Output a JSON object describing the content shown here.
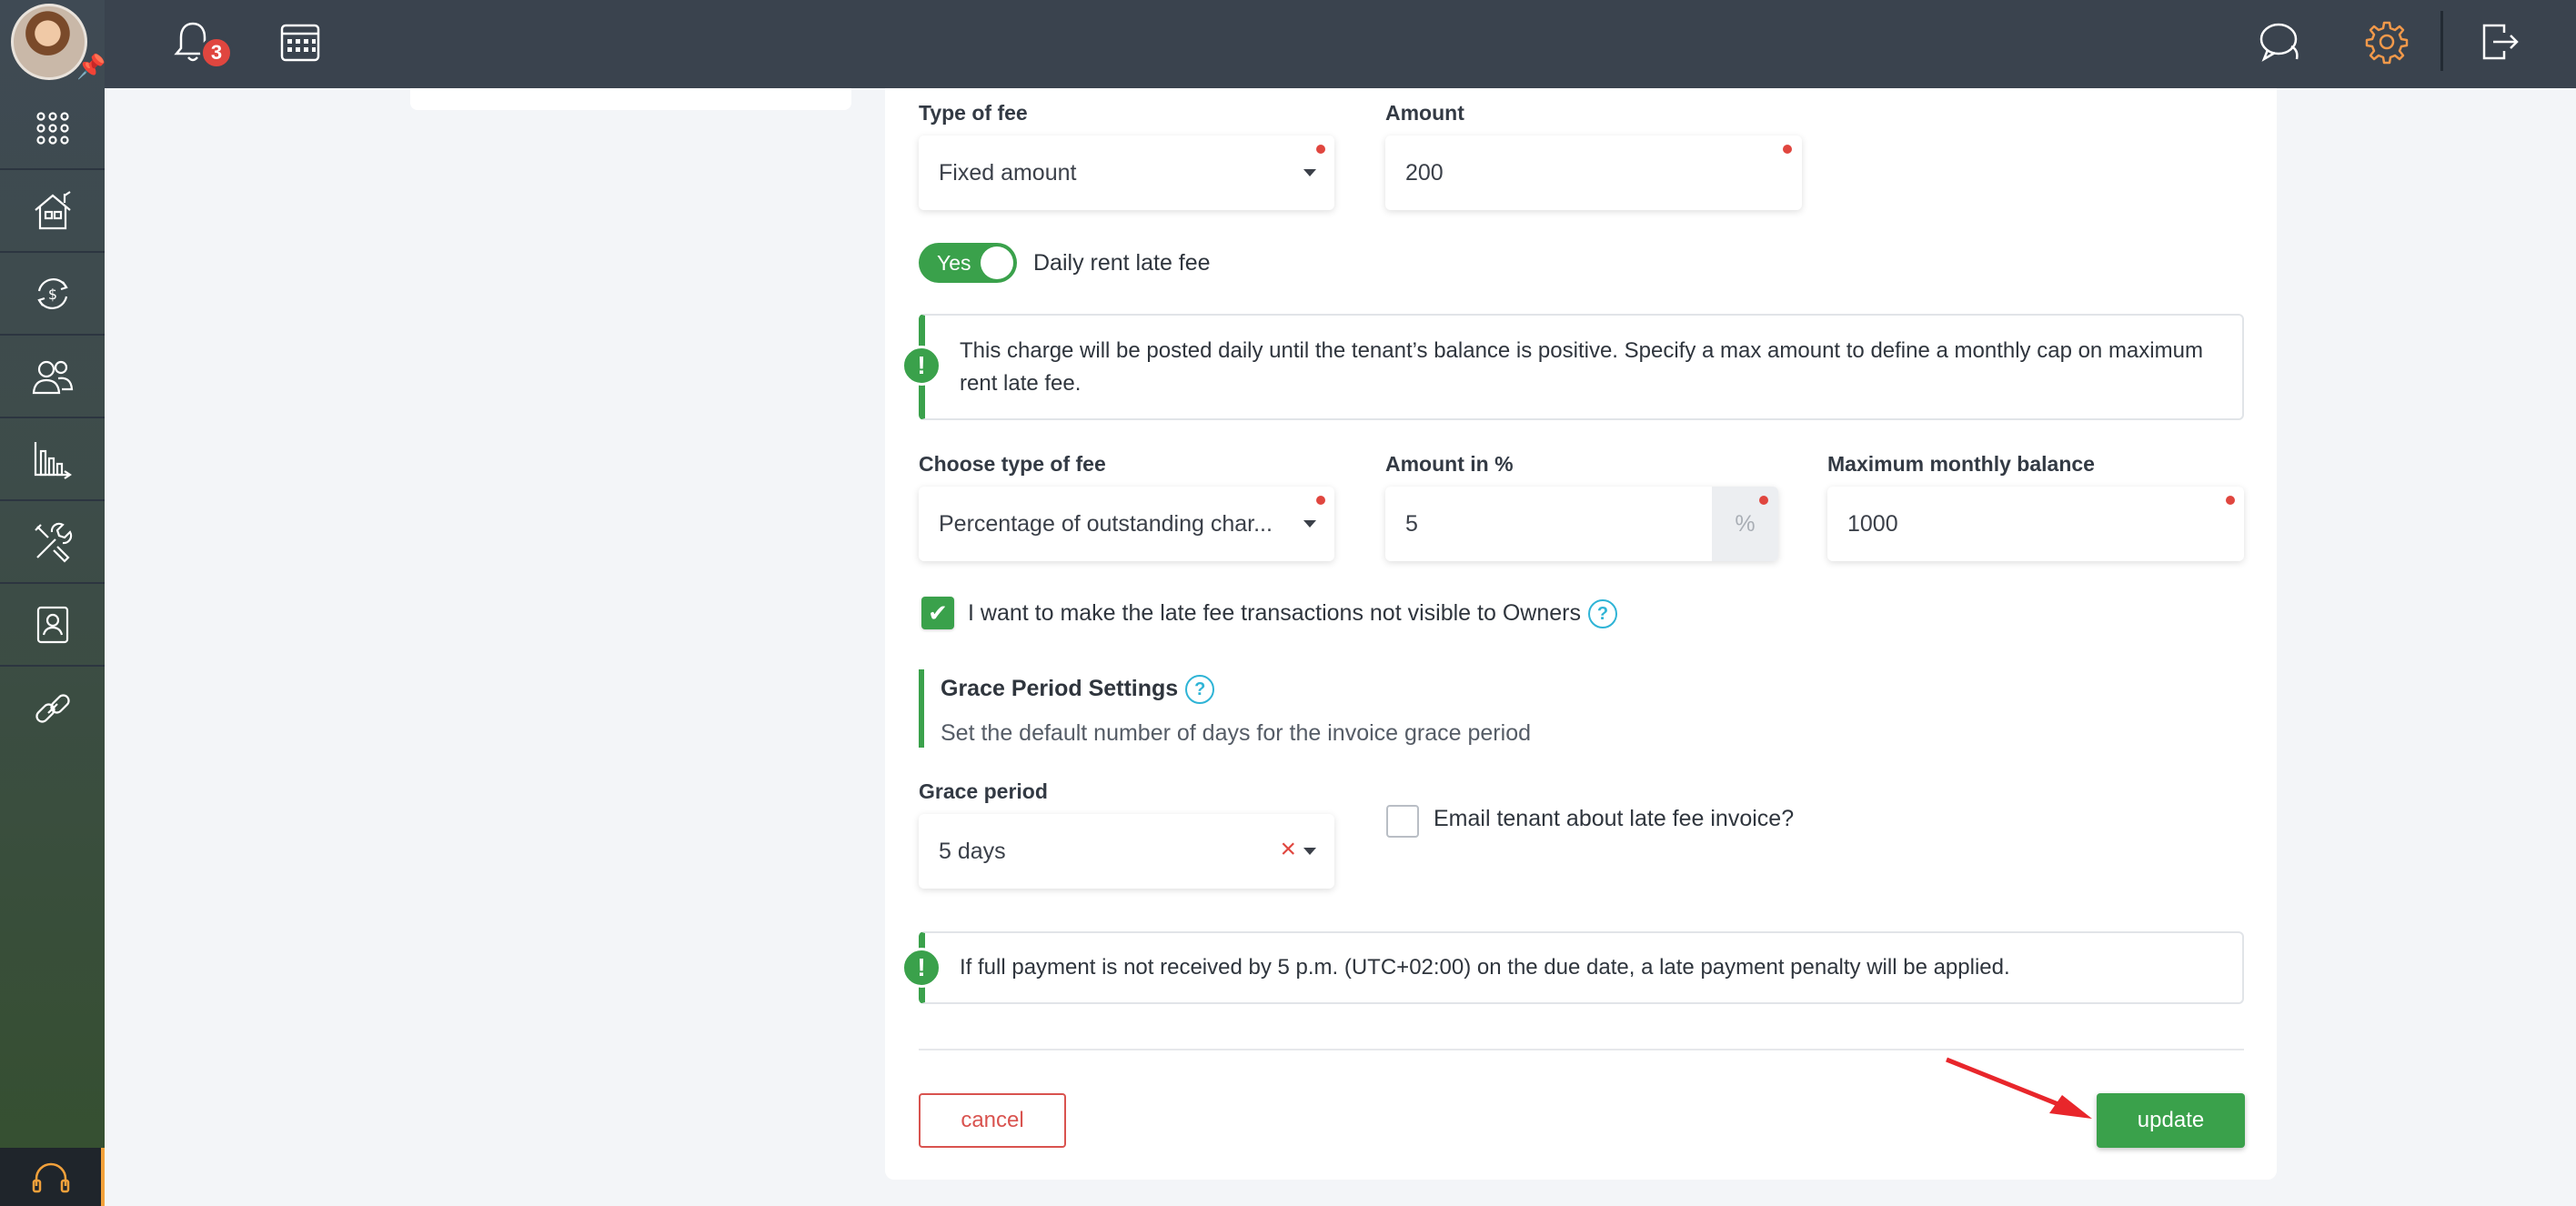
{
  "header": {
    "notifications_count": "3"
  },
  "sidebar": {
    "items": [
      "apps",
      "properties",
      "accounting",
      "people",
      "reports",
      "maintenance",
      "documents",
      "links"
    ]
  },
  "form": {
    "type_of_fee": {
      "label": "Type of fee",
      "value": "Fixed amount"
    },
    "amount": {
      "label": "Amount",
      "value": "200"
    },
    "daily_toggle": {
      "state": "Yes",
      "label": "Daily rent late fee"
    },
    "daily_info": "This charge will be posted daily until the tenant’s balance is positive. Specify a max amount to define a monthly cap on maximum rent late fee.",
    "choose_type": {
      "label": "Choose type of fee",
      "value": "Percentage of outstanding char..."
    },
    "amount_percent": {
      "label": "Amount in %",
      "value": "5",
      "suffix": "%"
    },
    "max_balance": {
      "label": "Maximum monthly balance",
      "value": "1000"
    },
    "owners_checkbox": {
      "label": "I want to make the late fee transactions not visible to Owners",
      "checked": true
    },
    "grace_settings": {
      "title": "Grace Period Settings",
      "description": "Set the default number of days for the invoice grace period"
    },
    "grace_period": {
      "label": "Grace period",
      "value": "5 days"
    },
    "email_checkbox": {
      "label": "Email tenant about late fee invoice?",
      "checked": false
    },
    "payment_info": "If full payment is not received by 5 p.m. (UTC+02:00) on the due date, a late payment penalty will be applied.",
    "cancel_label": "cancel",
    "update_label": "update"
  },
  "colors": {
    "accent_green": "#3aa14b",
    "danger_red": "#e0463f",
    "topbar": "#3a434e",
    "settings_active": "#f2994a"
  }
}
